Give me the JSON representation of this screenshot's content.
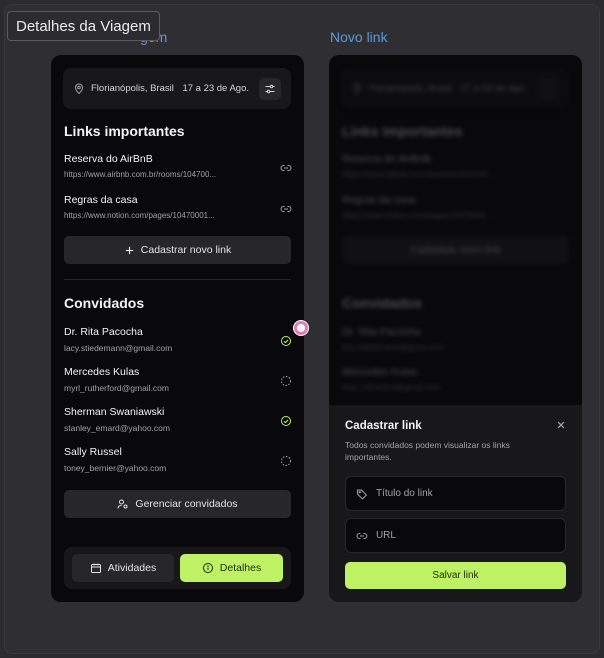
{
  "tooltip": "Detalhes da Viagem",
  "frames": {
    "left_title": "Detalhes da Viagem",
    "left_title_visible": "gem",
    "right_title": "Novo link"
  },
  "trip": {
    "destination": "Florianópolis, Brasil",
    "dates": "17 a 23 de Ago."
  },
  "links": {
    "title": "Links importantes",
    "items": [
      {
        "title": "Reserva do AirBnB",
        "url": "https://www.airbnb.com.br/rooms/104700..."
      },
      {
        "title": "Regras da casa",
        "url": "https://www.notion.com/pages/10470001..."
      }
    ],
    "add_button": "Cadastrar novo link"
  },
  "guests": {
    "title": "Convidados",
    "items": [
      {
        "name": "Dr. Rita Pacocha",
        "email": "lacy.stiedemann@gmail.com",
        "confirmed": true
      },
      {
        "name": "Mercedes Kulas",
        "email": "myrl_rutherford@gmail.com",
        "confirmed": false
      },
      {
        "name": "Sherman Swaniawski",
        "email": "stanley_emard@yahoo.com",
        "confirmed": true
      },
      {
        "name": "Sally Russel",
        "email": "toney_bernier@yahoo.com",
        "confirmed": false
      }
    ],
    "manage_button": "Gerenciar convidados"
  },
  "nav": {
    "activities": "Atividades",
    "details": "Detalhes"
  },
  "modal": {
    "title": "Cadastrar link",
    "description": "Todos convidados podem visualizar os links importantes.",
    "title_placeholder": "Título do link",
    "url_placeholder": "URL",
    "submit": "Salvar link"
  },
  "colors": {
    "accent": "#bef264",
    "confirmed": "#bef264",
    "frame_title": "#5b9bd5"
  }
}
